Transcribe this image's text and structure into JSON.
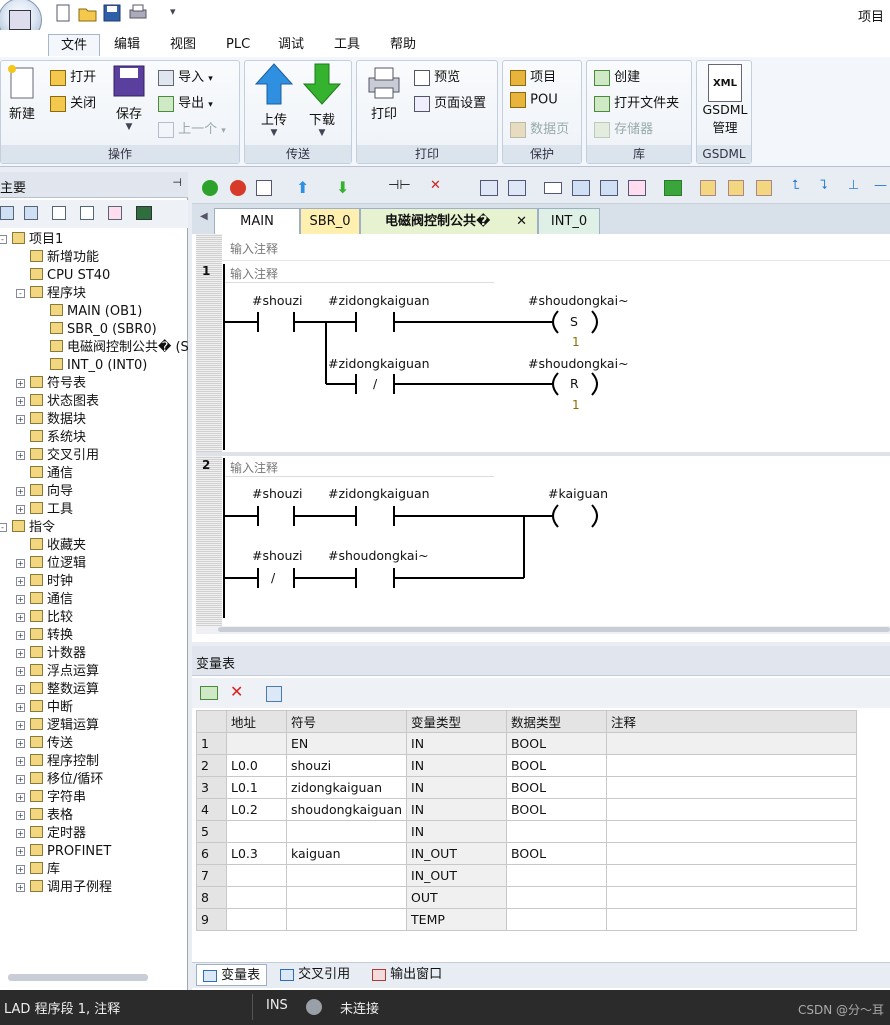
{
  "title_bar": {
    "right_text": "项目"
  },
  "menu_tabs": [
    "文件",
    "编辑",
    "视图",
    "PLC",
    "调试",
    "工具",
    "帮助"
  ],
  "ribbon": {
    "ops": {
      "label": "操作",
      "new": "新建",
      "open": "打开",
      "close": "关闭",
      "save": "保存",
      "import": "导入",
      "export": "导出",
      "prev": "上一个"
    },
    "transfer": {
      "label": "传送",
      "upload": "上传",
      "download": "下载"
    },
    "print": {
      "label": "打印",
      "print": "打印",
      "preview": "预览",
      "page_setup": "页面设置"
    },
    "protect": {
      "label": "保护",
      "project": "项目",
      "pou": "POU",
      "data_page": "数据页"
    },
    "library": {
      "label": "库",
      "create": "创建",
      "open_folder": "打开文件夹",
      "memory": "存储器"
    },
    "gsdml": {
      "label": "GSDML",
      "line1": "GSDML",
      "line2": "管理",
      "xml": "XML"
    }
  },
  "left_panel": {
    "header": "主要",
    "tree": [
      {
        "text": "项目1",
        "level": 0,
        "expander": "-"
      },
      {
        "text": "新增功能",
        "level": 1,
        "expander": ""
      },
      {
        "text": "CPU ST40",
        "level": 1,
        "expander": ""
      },
      {
        "text": "程序块",
        "level": 1,
        "expander": "-"
      },
      {
        "text": "MAIN (OB1)",
        "level": 2,
        "expander": ""
      },
      {
        "text": "SBR_0 (SBR0)",
        "level": 2,
        "expander": ""
      },
      {
        "text": "电磁阀控制公共� (SB",
        "level": 2,
        "expander": ""
      },
      {
        "text": "INT_0 (INT0)",
        "level": 2,
        "expander": ""
      },
      {
        "text": "符号表",
        "level": 1,
        "expander": "+"
      },
      {
        "text": "状态图表",
        "level": 1,
        "expander": "+"
      },
      {
        "text": "数据块",
        "level": 1,
        "expander": "+"
      },
      {
        "text": "系统块",
        "level": 1,
        "expander": ""
      },
      {
        "text": "交叉引用",
        "level": 1,
        "expander": "+"
      },
      {
        "text": "通信",
        "level": 1,
        "expander": ""
      },
      {
        "text": "向导",
        "level": 1,
        "expander": "+"
      },
      {
        "text": "工具",
        "level": 1,
        "expander": "+"
      },
      {
        "text": "指令",
        "level": 0,
        "expander": "-"
      },
      {
        "text": "收藏夹",
        "level": 1,
        "expander": ""
      },
      {
        "text": "位逻辑",
        "level": 1,
        "expander": "+"
      },
      {
        "text": "时钟",
        "level": 1,
        "expander": "+"
      },
      {
        "text": "通信",
        "level": 1,
        "expander": "+"
      },
      {
        "text": "比较",
        "level": 1,
        "expander": "+"
      },
      {
        "text": "转换",
        "level": 1,
        "expander": "+"
      },
      {
        "text": "计数器",
        "level": 1,
        "expander": "+"
      },
      {
        "text": "浮点运算",
        "level": 1,
        "expander": "+"
      },
      {
        "text": "整数运算",
        "level": 1,
        "expander": "+"
      },
      {
        "text": "中断",
        "level": 1,
        "expander": "+"
      },
      {
        "text": "逻辑运算",
        "level": 1,
        "expander": "+"
      },
      {
        "text": "传送",
        "level": 1,
        "expander": "+"
      },
      {
        "text": "程序控制",
        "level": 1,
        "expander": "+"
      },
      {
        "text": "移位/循环",
        "level": 1,
        "expander": "+"
      },
      {
        "text": "字符串",
        "level": 1,
        "expander": "+"
      },
      {
        "text": "表格",
        "level": 1,
        "expander": "+"
      },
      {
        "text": "定时器",
        "level": 1,
        "expander": "+"
      },
      {
        "text": "PROFINET",
        "level": 1,
        "expander": "+"
      },
      {
        "text": "库",
        "level": 1,
        "expander": "+"
      },
      {
        "text": "调用子例程",
        "level": 1,
        "expander": "+"
      }
    ]
  },
  "editor": {
    "tabs": [
      "MAIN",
      "SBR_0",
      "电磁阀控制公共�",
      "INT_0"
    ],
    "tab_close": "✕",
    "block_comment": "输入注释",
    "networks": [
      {
        "number": "1",
        "comment": "输入注释",
        "row1": {
          "c1": "#shouzi",
          "c2": "#zidongkaiguan",
          "coil": "#shoudongkai~",
          "coil_type": "S",
          "coil_param": "1"
        },
        "row2": {
          "c2": "#zidongkaiguan",
          "c2_type": "/",
          "coil": "#shoudongkai~",
          "coil_type": "R",
          "coil_param": "1"
        }
      },
      {
        "number": "2",
        "comment": "输入注释",
        "row1": {
          "c1": "#shouzi",
          "c2": "#zidongkaiguan",
          "coil": "#kaiguan"
        },
        "row2": {
          "c1": "#shouzi",
          "c1_type": "/",
          "c2": "#shoudongkai~"
        }
      }
    ]
  },
  "var_table": {
    "title": "变量表",
    "columns": [
      "地址",
      "符号",
      "变量类型",
      "数据类型",
      "注释"
    ],
    "rows": [
      {
        "idx": "1",
        "addr": "",
        "sym": "EN",
        "vtype": "IN",
        "dtype": "BOOL",
        "comment": ""
      },
      {
        "idx": "2",
        "addr": "L0.0",
        "sym": "shouzi",
        "vtype": "IN",
        "dtype": "BOOL",
        "comment": ""
      },
      {
        "idx": "3",
        "addr": "L0.1",
        "sym": "zidongkaiguan",
        "vtype": "IN",
        "dtype": "BOOL",
        "comment": ""
      },
      {
        "idx": "4",
        "addr": "L0.2",
        "sym": "shoudongkaiguan",
        "vtype": "IN",
        "dtype": "BOOL",
        "comment": ""
      },
      {
        "idx": "5",
        "addr": "",
        "sym": "",
        "vtype": "IN",
        "dtype": "",
        "comment": ""
      },
      {
        "idx": "6",
        "addr": "L0.3",
        "sym": "kaiguan",
        "vtype": "IN_OUT",
        "dtype": "BOOL",
        "comment": ""
      },
      {
        "idx": "7",
        "addr": "",
        "sym": "",
        "vtype": "IN_OUT",
        "dtype": "",
        "comment": ""
      },
      {
        "idx": "8",
        "addr": "",
        "sym": "",
        "vtype": "OUT",
        "dtype": "",
        "comment": ""
      },
      {
        "idx": "9",
        "addr": "",
        "sym": "",
        "vtype": "TEMP",
        "dtype": "",
        "comment": ""
      }
    ],
    "bottom_tabs": [
      "变量表",
      "交叉引用",
      "输出窗口"
    ]
  },
  "status_bar": {
    "mode": "LAD 程序段 1, 注释",
    "ins": "INS",
    "connection": "未连接",
    "watermark": "CSDN @分～耳"
  },
  "colors": {
    "accent": "#2e6fb7",
    "active_tab_main": "#ffffff",
    "tab_sbr": "#fff0b0",
    "tab_valve": "#e6f2d0",
    "tab_int": "#dff0e6",
    "ladder_param": "#8a7000"
  }
}
